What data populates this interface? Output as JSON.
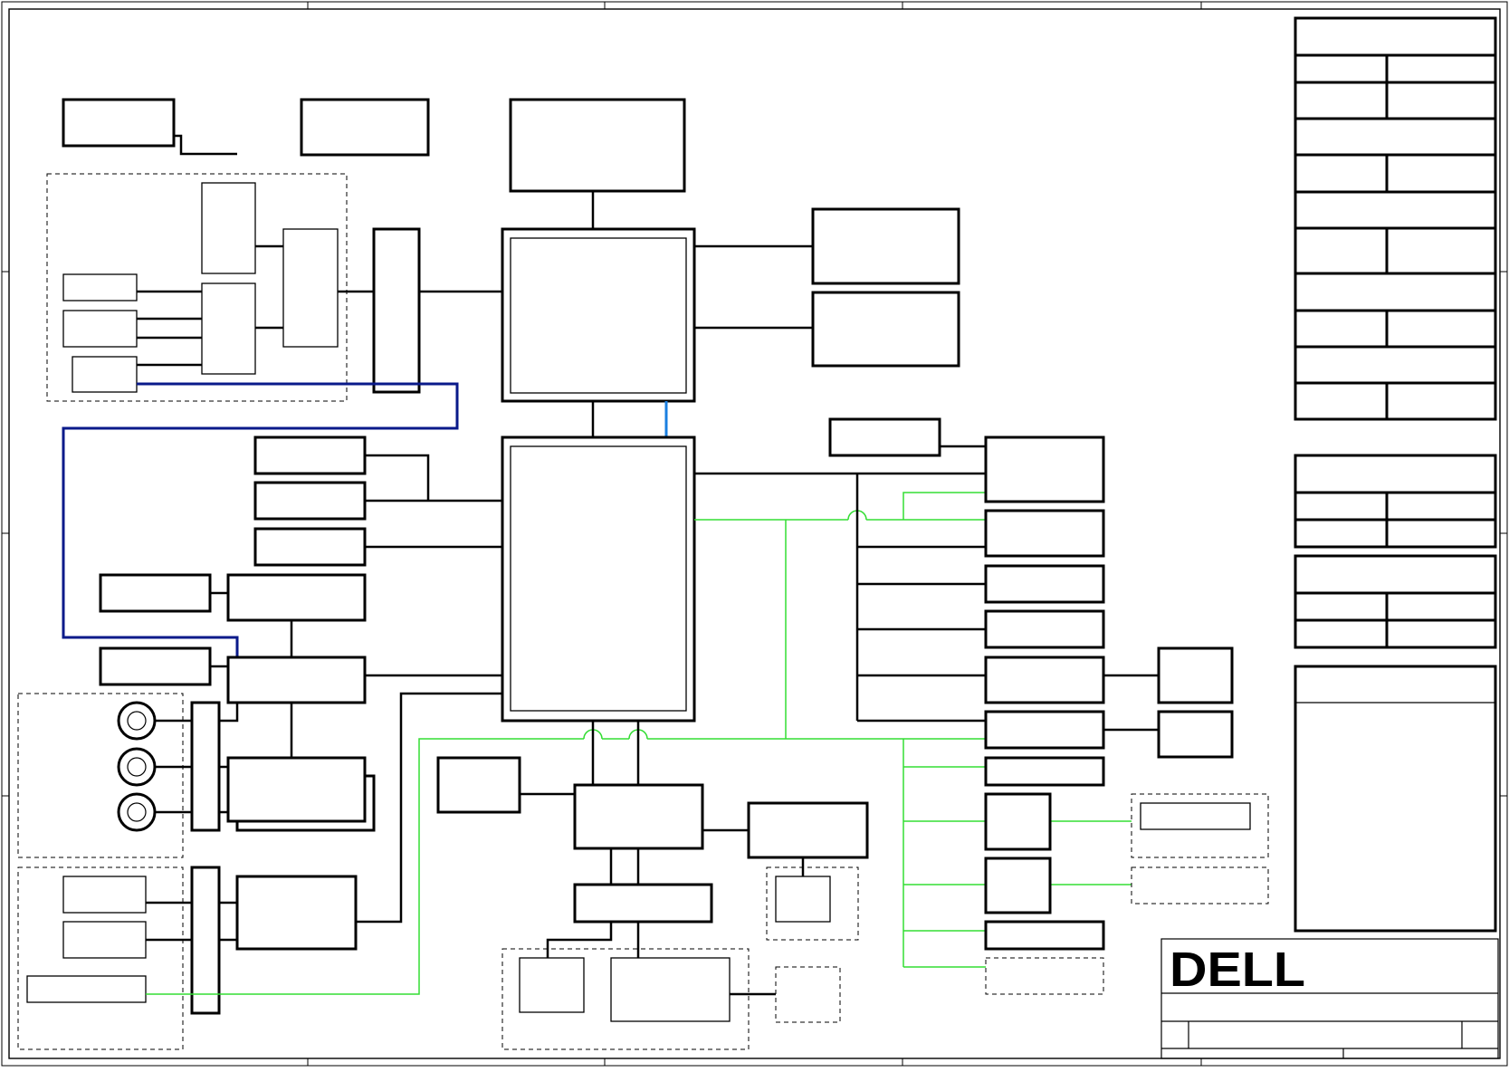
{
  "page": {
    "title": "",
    "logo_text": "DELL"
  },
  "title_block": {
    "fields": []
  },
  "colors": {
    "line": "#000000",
    "green_line": "#33dd33",
    "navy_line": "#0a1a8a",
    "blue_link": "#1a7fe0",
    "paper": "#ffffff"
  },
  "icons": [
    "connector-ring-icon",
    "dell-logo"
  ]
}
